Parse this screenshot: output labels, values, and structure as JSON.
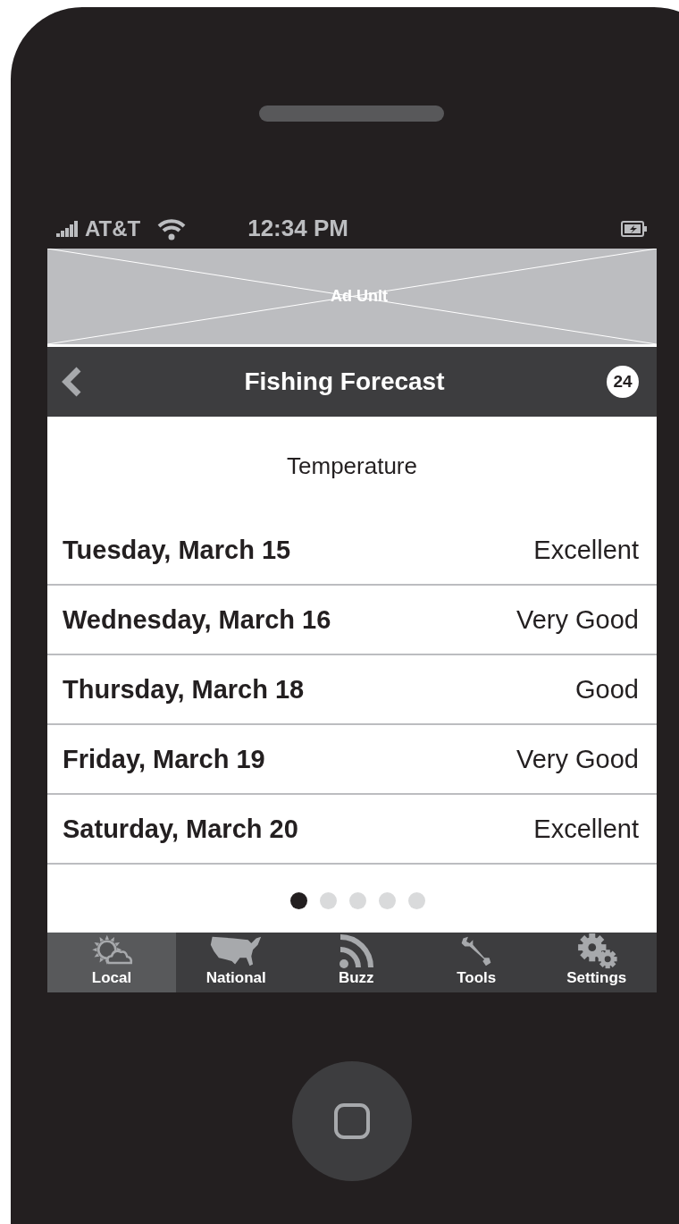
{
  "status_bar": {
    "carrier": "AT&T",
    "time": "12:34 PM"
  },
  "ad": {
    "label": "Ad Unit"
  },
  "nav_bar": {
    "title": "Fishing Forecast",
    "badge": "24"
  },
  "heading": "Temperature",
  "rows": [
    {
      "date": "Tuesday, March 15",
      "rating": "Excellent"
    },
    {
      "date": "Wednesday, March 16",
      "rating": "Very Good"
    },
    {
      "date": "Thursday, March 18",
      "rating": "Good"
    },
    {
      "date": "Friday, March 19",
      "rating": "Very Good"
    },
    {
      "date": "Saturday, March 20",
      "rating": "Excellent"
    }
  ],
  "page_dots": [
    {
      "selected": true
    },
    {
      "selected": false
    },
    {
      "selected": false
    },
    {
      "selected": false
    },
    {
      "selected": false
    }
  ],
  "tabs": [
    {
      "kind": "weather",
      "label": "Local",
      "selected": true
    },
    {
      "kind": "map",
      "label": "National",
      "selected": false
    },
    {
      "kind": "feed",
      "label": "Buzz",
      "selected": false
    },
    {
      "kind": "wrench",
      "label": "Tools",
      "selected": false
    },
    {
      "kind": "gears",
      "label": "Settings",
      "selected": false
    }
  ]
}
